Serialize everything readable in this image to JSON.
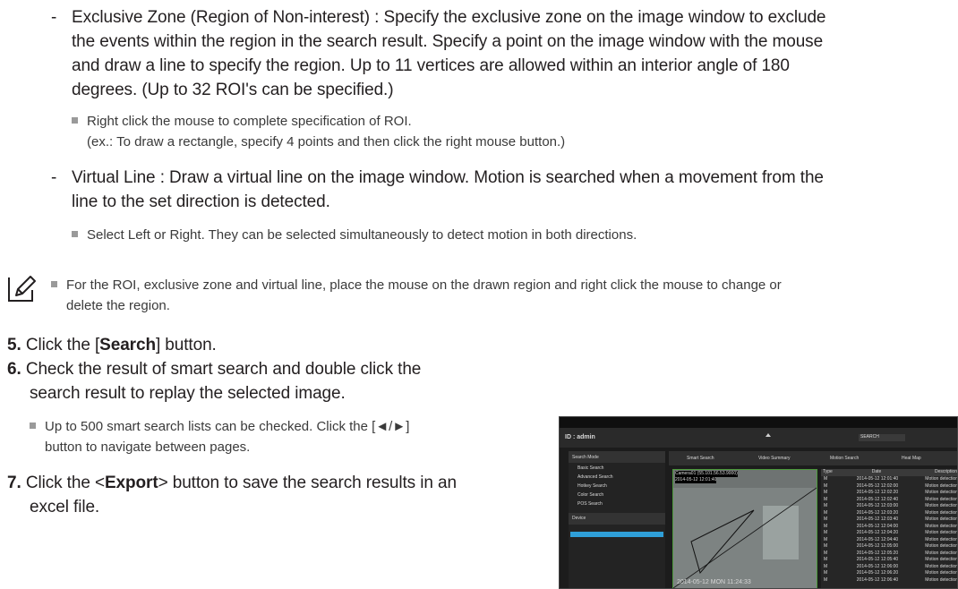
{
  "items": {
    "exclusive_zone": {
      "dash": "-",
      "line1": "Exclusive Zone (Region of Non-interest) : Specify the exclusive zone on the image window to exclude",
      "line2": "the events within the region in the search result. Specify a point on the image window with the mouse",
      "line3": "and draw a line to specify the region. Up to 11 vertices are allowed within an interior angle of 180",
      "line4": "degrees. (Up to 32 ROI's can be specified.)",
      "note1": "Right click the mouse to complete specification of ROI.",
      "note2": "(ex.: To draw a rectangle, specify 4 points and then click the right mouse button.)"
    },
    "virtual_line": {
      "dash": "-",
      "line1": "Virtual Line : Draw a virtual line on the image window. Motion is searched when a movement from the",
      "line2": "line to the set direction is detected.",
      "note1": "Select Left or Right. They can be selected simultaneously to detect motion in both directions."
    }
  },
  "memo": {
    "line1": "For the ROI, exclusive zone and virtual line, place the mouse on the drawn region and right click the mouse to change or",
    "line2": "delete the region."
  },
  "steps": [
    {
      "num": "5.",
      "pre": "Click the [",
      "bold": "Search",
      "post": "] button."
    },
    {
      "num": "6.",
      "line1": "Check the result of smart search and double click the",
      "line2": "search result to replay the selected image.",
      "note1": "Up to 500 smart search lists can be checked. Click the [◄/►]",
      "note2": "button to navigate between pages."
    },
    {
      "num": "7.",
      "pre": "Click the <",
      "bold": "Export",
      "post": "> button to save the search results in an",
      "line2": "excel file."
    }
  ],
  "screenshot": {
    "id_label": "ID : admin",
    "search_field": "SEARCH",
    "search_mode": "Search Mode",
    "modes": [
      "Basic Search",
      "Advanced Search",
      "Hotkey Search",
      "Color Search",
      "POS Search"
    ],
    "device": "Device",
    "tabs": [
      "Smart Search",
      "Video Summary",
      "Motion Search",
      "Heat Map"
    ],
    "cam_label": "Camera01 (55.101.56.53.9000)",
    "date_label": "2014-05-12 12:01:40",
    "bottom_stamp": "2014-05-12 MON 11:24:33",
    "list_headers": [
      "Type",
      "Date",
      "Description"
    ],
    "rows": [
      [
        "M",
        "2014-05-12 12:01:40",
        "Motion detection"
      ],
      [
        "M",
        "2014-05-12 12:02:00",
        "Motion detection"
      ],
      [
        "M",
        "2014-05-12 12:02:20",
        "Motion detection"
      ],
      [
        "M",
        "2014-05-12 12:02:40",
        "Motion detection"
      ],
      [
        "M",
        "2014-05-12 12:03:00",
        "Motion detection"
      ],
      [
        "M",
        "2014-05-12 12:03:20",
        "Motion detection"
      ],
      [
        "M",
        "2014-05-12 12:03:40",
        "Motion detection"
      ],
      [
        "M",
        "2014-05-12 12:04:00",
        "Motion detection"
      ],
      [
        "M",
        "2014-05-12 12:04:20",
        "Motion detection"
      ],
      [
        "M",
        "2014-05-12 12:04:40",
        "Motion detection"
      ],
      [
        "M",
        "2014-05-12 12:05:00",
        "Motion detection"
      ],
      [
        "M",
        "2014-05-12 12:05:20",
        "Motion detection"
      ],
      [
        "M",
        "2014-05-12 12:05:40",
        "Motion detection"
      ],
      [
        "M",
        "2014-05-12 12:06:00",
        "Motion detection"
      ],
      [
        "M",
        "2014-05-12 12:06:20",
        "Motion detection"
      ],
      [
        "M",
        "2014-05-12 12:06:40",
        "Motion detection"
      ]
    ]
  },
  "colors": {
    "accent_green": "#4d9a3c",
    "highlight_blue": "#2f9fd8",
    "bullet_grey": "#9a9a9a"
  }
}
